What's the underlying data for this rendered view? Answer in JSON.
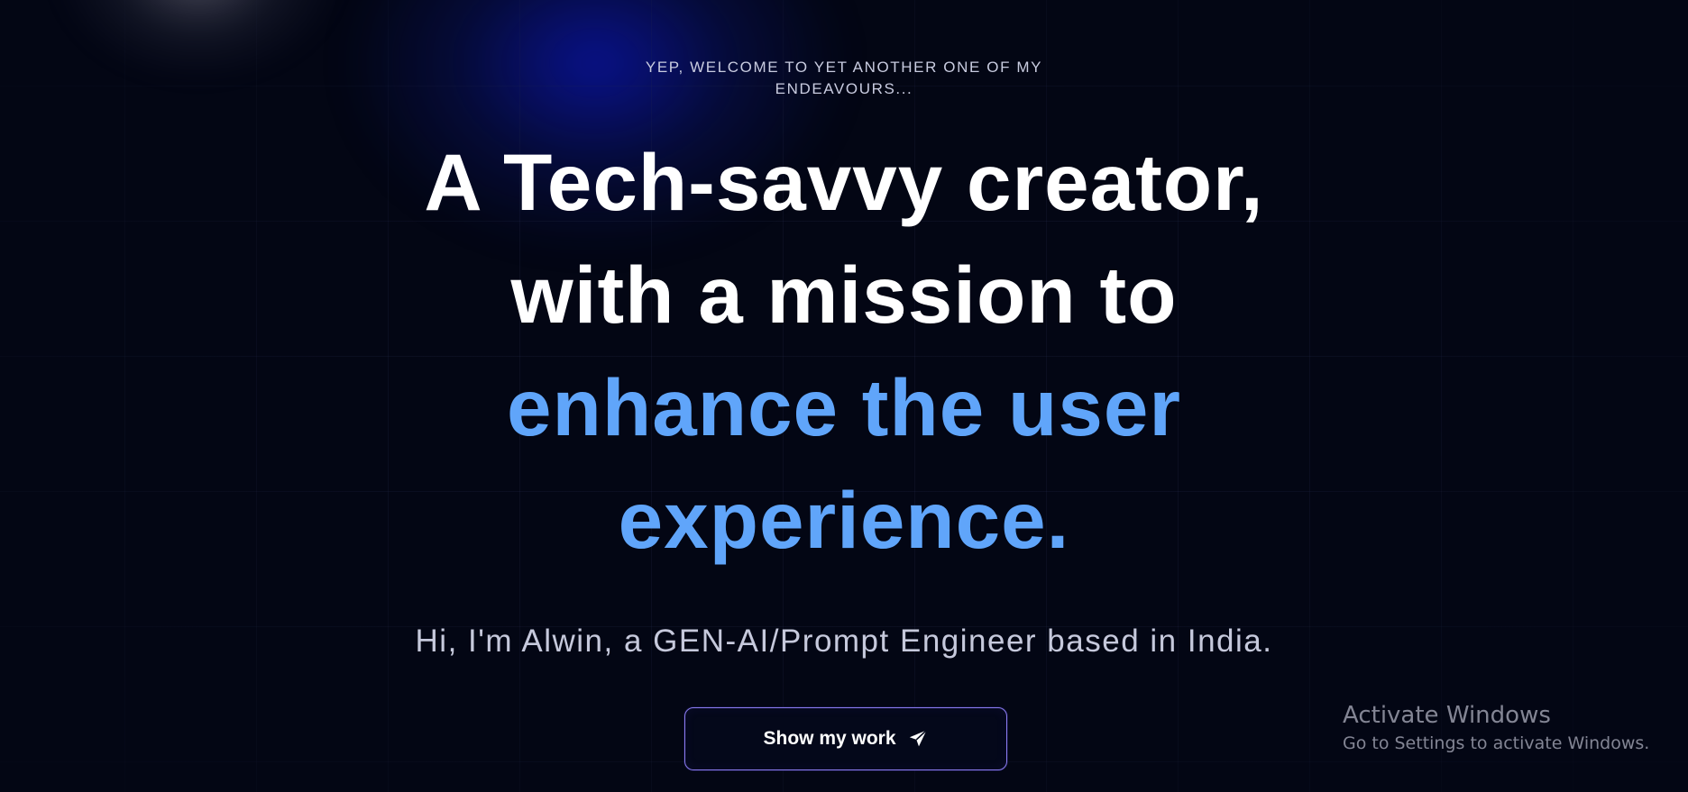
{
  "hero": {
    "eyebrow": "YEP, WELCOME TO YET ANOTHER ONE OF MY ENDEAVOURS...",
    "headline_line1": "A Tech-savvy creator,",
    "headline_line2": "with a mission to",
    "headline_line3": "enhance the user",
    "headline_line4": "experience.",
    "subline": "Hi, I'm Alwin, a GEN-AI/Prompt Engineer based in India."
  },
  "cta": {
    "label": "Show my work",
    "icon": "send-icon"
  },
  "watermark": {
    "title": "Activate Windows",
    "subtitle": "Go to Settings to activate Windows."
  },
  "colors": {
    "background": "#030614",
    "accent": "#60a5fa",
    "button_border": "#8b7cf0",
    "muted_text": "#c6c9dc"
  }
}
